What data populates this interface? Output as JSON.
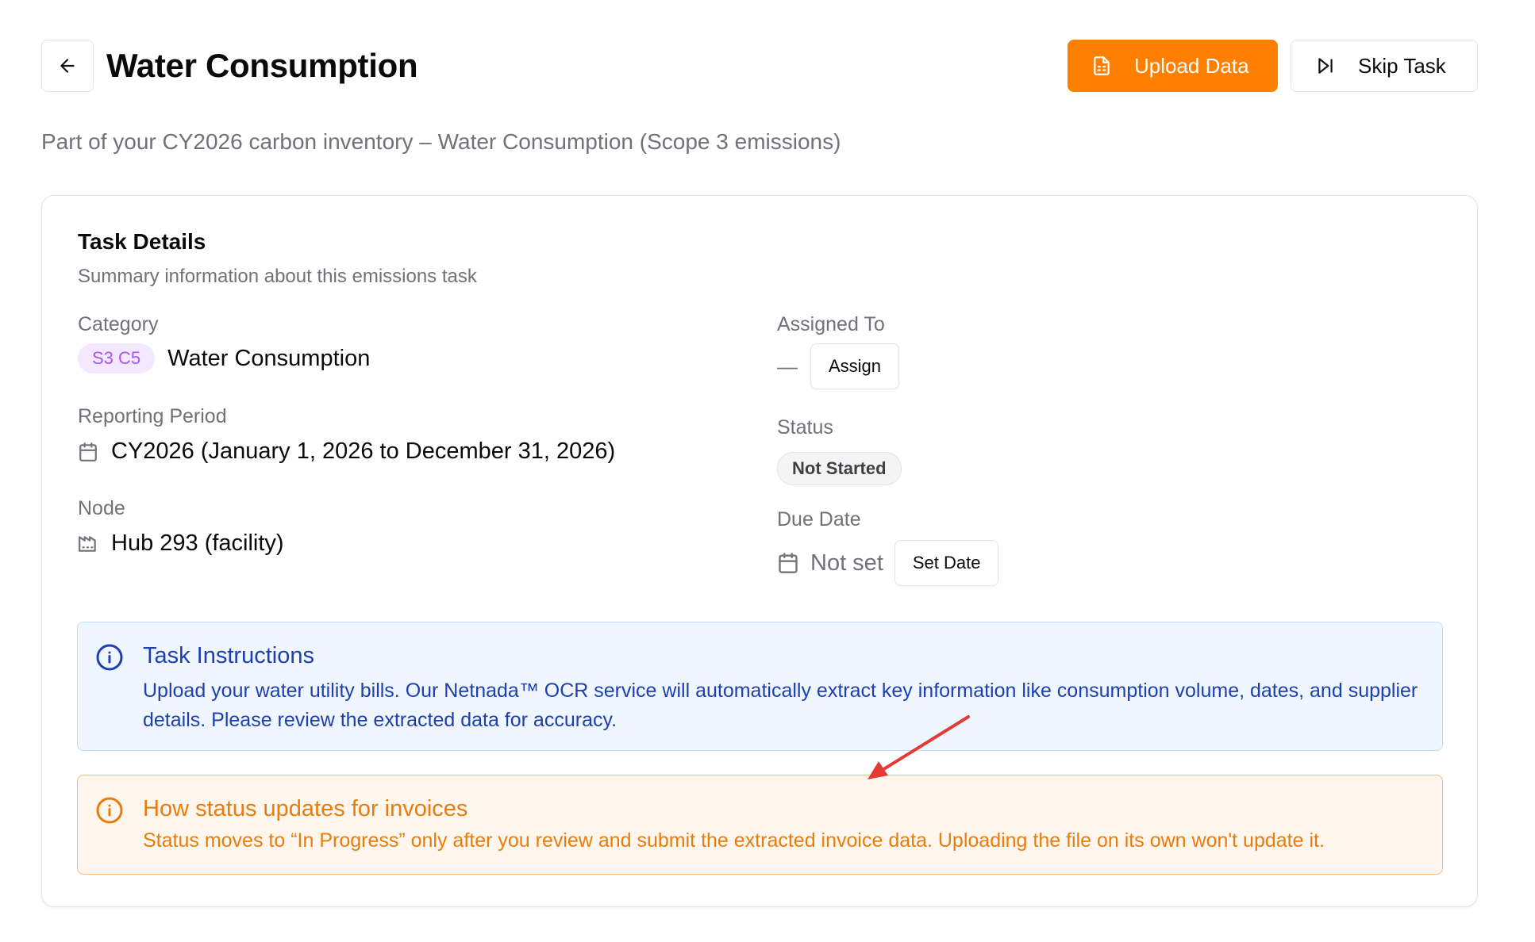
{
  "header": {
    "title": "Water Consumption",
    "upload_label": "Upload Data",
    "skip_label": "Skip Task"
  },
  "subtitle": "Part of your CY2026 carbon inventory – Water Consumption (Scope 3 emissions)",
  "card": {
    "title": "Task Details",
    "description": "Summary information about this emissions task",
    "category": {
      "label": "Category",
      "badge": "S3 C5",
      "value": "Water Consumption"
    },
    "reporting_period": {
      "label": "Reporting Period",
      "value": "CY2026 (January 1, 2026 to December 31, 2026)"
    },
    "node": {
      "label": "Node",
      "value": "Hub 293 (facility)"
    },
    "assigned_to": {
      "label": "Assigned To",
      "value": "—",
      "button": "Assign"
    },
    "status": {
      "label": "Status",
      "value": "Not Started"
    },
    "due_date": {
      "label": "Due Date",
      "value": "Not set",
      "button": "Set Date"
    }
  },
  "instructions": {
    "title": "Task Instructions",
    "text": "Upload your water utility bills. Our Netnada™ OCR service will automatically extract key information like consumption volume, dates, and supplier details. Please review the extracted data for accuracy."
  },
  "notice": {
    "title": "How status updates for invoices",
    "text": "Status moves to “In Progress” only after you review and submit the extracted invoice data. Uploading the file on its own won't update it."
  },
  "colors": {
    "accent": "#ff8000",
    "info": "#1e40af",
    "warning": "#ea7c0c",
    "annotation_arrow": "#e53935"
  }
}
